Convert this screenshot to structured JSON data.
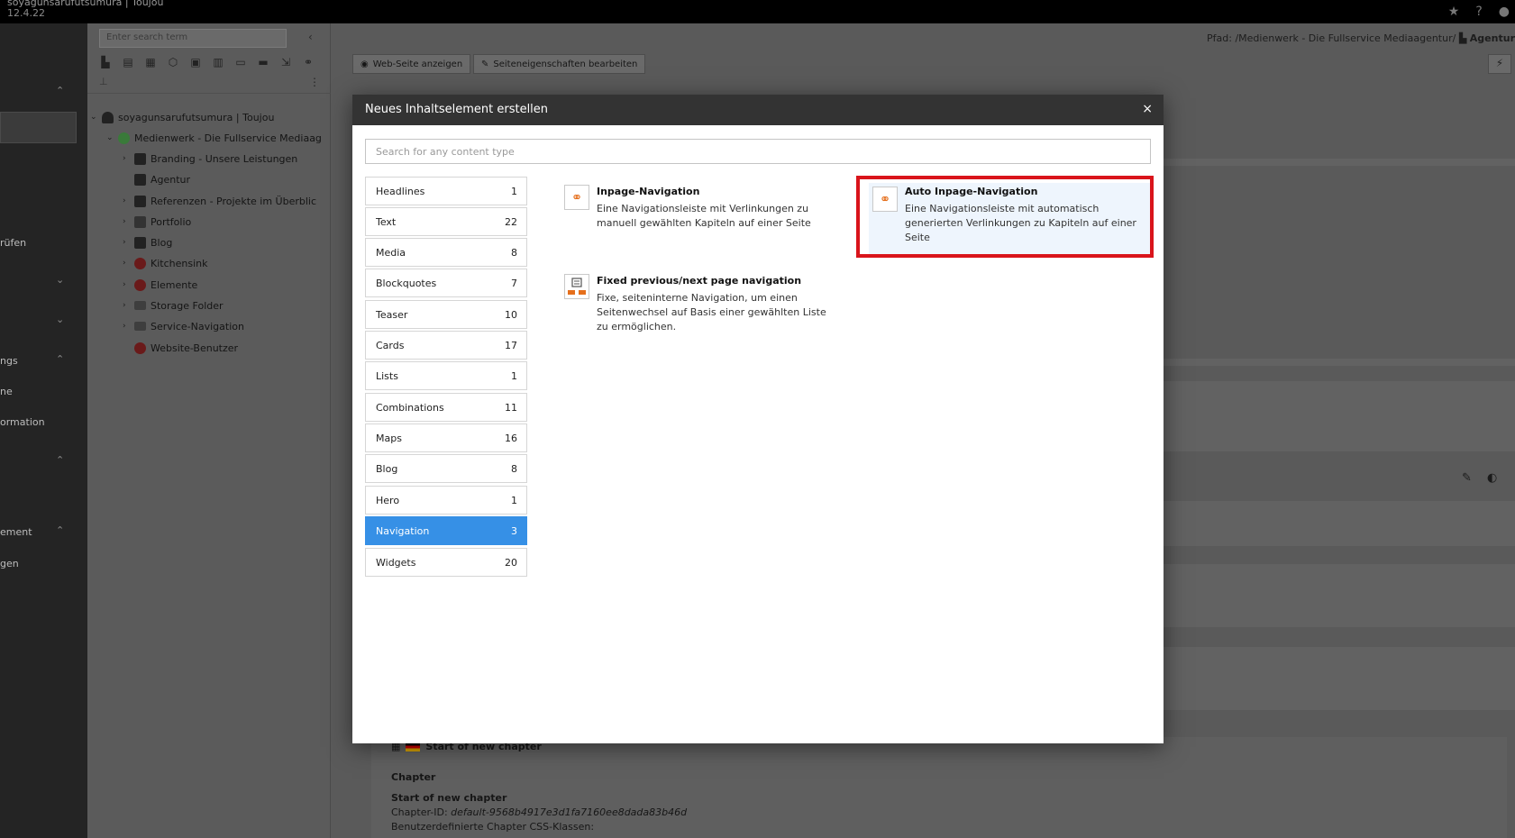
{
  "topbar": {
    "site_name": "soyagunsarufutsumura | Toujou",
    "version": "12.4.22",
    "icons": [
      "star-icon",
      "help-icon",
      "user-icon"
    ]
  },
  "module_menu": {
    "items": [
      {
        "label": "",
        "chevron": "⌃"
      },
      {
        "label": "rüfen",
        "chevron": ""
      },
      {
        "label": "",
        "chevron": "⌄"
      },
      {
        "label": "",
        "chevron": "⌄"
      },
      {
        "label": "ngs",
        "chevron": "⌃"
      },
      {
        "label": "ne",
        "chevron": ""
      },
      {
        "label": "ormation",
        "chevron": ""
      },
      {
        "label": "",
        "chevron": "⌃"
      },
      {
        "label": "ement",
        "chevron": "⌃"
      },
      {
        "label": "gen",
        "chevron": ""
      }
    ]
  },
  "page_tree": {
    "search_placeholder": "Enter search term",
    "nodes": [
      {
        "label": "soyagunsarufutsumura | Toujou",
        "toggle": "⌄",
        "icon": "typo3-logo-icon"
      },
      {
        "label": "Medienwerk - Die Fullservice Mediaag",
        "toggle": "⌄",
        "icon": "globe-icon"
      },
      {
        "label": "Branding - Unsere Leistungen",
        "toggle": "›",
        "icon": "page-icon"
      },
      {
        "label": "Agentur",
        "toggle": "",
        "icon": "page-icon"
      },
      {
        "label": "Referenzen - Projekte im Überblic",
        "toggle": "›",
        "icon": "page-icon"
      },
      {
        "label": "Portfolio",
        "toggle": "›",
        "icon": "grid-icon"
      },
      {
        "label": "Blog",
        "toggle": "›",
        "icon": "page-icon"
      },
      {
        "label": "Kitchensink",
        "toggle": "›",
        "icon": "restricted-page-icon"
      },
      {
        "label": "Elemente",
        "toggle": "›",
        "icon": "restricted-page-icon"
      },
      {
        "label": "Storage Folder",
        "toggle": "›",
        "icon": "folder-icon"
      },
      {
        "label": "Service-Navigation",
        "toggle": "›",
        "icon": "folder-icon"
      },
      {
        "label": "Website-Benutzer",
        "toggle": "",
        "icon": "restricted-folder-icon"
      }
    ]
  },
  "main": {
    "path_label": "Pfad: /Medienwerk - Die Fullservice Mediaagentur/",
    "path_current": "Agentur",
    "view_button": "Web-Seite anzeigen",
    "edit_button": "Seiteneigenschaften bearbeiten",
    "chapter": {
      "header": "Start of new chapter",
      "type": "Chapter",
      "title": "Start of new chapter",
      "id_label": "Chapter-ID:",
      "id_value": "default-9568b4917e3d1fa7160ee8dada83b46d",
      "css_label": "Benutzerdefinierte Chapter CSS-Klassen:"
    }
  },
  "modal": {
    "title": "Neues Inhaltselement erstellen",
    "close": "×",
    "search_placeholder": "Search for any content type",
    "categories": [
      {
        "name": "Headlines",
        "count": "1"
      },
      {
        "name": "Text",
        "count": "22"
      },
      {
        "name": "Media",
        "count": "8"
      },
      {
        "name": "Blockquotes",
        "count": "7"
      },
      {
        "name": "Teaser",
        "count": "10"
      },
      {
        "name": "Cards",
        "count": "17"
      },
      {
        "name": "Lists",
        "count": "1"
      },
      {
        "name": "Combinations",
        "count": "11"
      },
      {
        "name": "Maps",
        "count": "16"
      },
      {
        "name": "Blog",
        "count": "8"
      },
      {
        "name": "Hero",
        "count": "1"
      },
      {
        "name": "Navigation",
        "count": "3",
        "selected": true
      },
      {
        "name": "Widgets",
        "count": "20"
      }
    ],
    "elements": [
      {
        "title": "Inpage-Navigation",
        "description": "Eine Navigationsleiste mit Verlinkungen zu manuell gewählten Kapiteln auf einer Seite",
        "icon": "link-icon"
      },
      {
        "title": "Auto Inpage-Navigation",
        "description": "Eine Navigationsleiste mit automatisch generierten Verlinkungen zu Kapiteln auf einer Seite",
        "icon": "link-icon",
        "highlighted": true
      },
      {
        "title": "Fixed previous/next page navigation",
        "description": "Fixe, seiteninterne Navigation, um einen Seitenwechsel auf Basis einer gewählten Liste zu ermöglichen.",
        "icon": "page-navigation-icon"
      }
    ]
  },
  "colors": {
    "accent": "#3690e6",
    "highlight_border": "#d9141b",
    "icon_orange": "#e56f1c",
    "modal_header": "#333333"
  }
}
